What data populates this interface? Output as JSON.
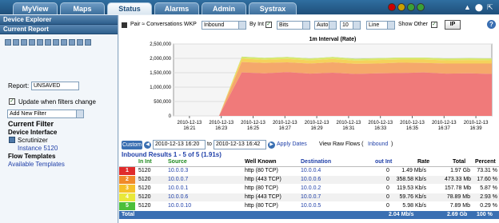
{
  "tabs": [
    "MyView",
    "Maps",
    "Status",
    "Alarms",
    "Admin",
    "Systrax"
  ],
  "active_tab": "Status",
  "status_lights": [
    "#cc0000",
    "#c9a000",
    "#3aa035",
    "#3aa035"
  ],
  "top_icons": [
    "▲",
    "⬤",
    "⇱"
  ],
  "sidebar": {
    "device_explorer": "Device Explorer",
    "current_report": "Current Report",
    "report_label": "Report:",
    "report_value": "UNSAVED",
    "update_label": "Update when filters change",
    "add_filter": "Add New Filter",
    "current_filter_title": "Current Filter",
    "device_interface_label": "Device Interface",
    "device_name": "Scrutinizer",
    "instance": "Instance 5120",
    "flow_templates_label": "Flow Templates",
    "available_templates": "Available Templates"
  },
  "controls": {
    "report_type": "Pair ≈ Conversations WKP",
    "direction": "Inbound",
    "by_int": "By Int",
    "unit": "Bits",
    "scale": "Auto",
    "top_n": "10",
    "graph_type": "Line",
    "show_other": "Show Other",
    "ip_button": "IP",
    "help": "?"
  },
  "chart_data": {
    "type": "area",
    "title": "1m Interval (Rate)",
    "ylim": [
      0,
      2500000
    ],
    "yticks": [
      "2,500,000",
      "2,000,000",
      "1,500,000",
      "1,000,000",
      "500,000",
      "0"
    ],
    "xticks": [
      "2010-12-13 16:21",
      "2010-12-13 16:23",
      "2010-12-13 16:25",
      "2010-12-13 16:27",
      "2010-12-13 16:29",
      "2010-12-13 16:31",
      "2010-12-13 16:33",
      "2010-12-13 16:35",
      "2010-12-13 16:37",
      "2010-12-13 16:39"
    ],
    "x": [
      16.35,
      16.43,
      16.45,
      16.5,
      16.55,
      16.6,
      16.65,
      16.7,
      16.75,
      16.8
    ],
    "series": [
      {
        "color": "#f07a7a",
        "values": [
          0,
          0,
          0,
          1510000,
          1480000,
          1520000,
          1470000,
          1500000,
          1460000,
          1480000,
          1490000,
          1510000,
          1470000,
          1480000,
          1460000
        ]
      },
      {
        "color": "#f5a86b",
        "values": [
          0,
          0,
          0,
          360000,
          360000,
          340000,
          350000,
          360000,
          350000,
          340000,
          360000,
          330000,
          350000,
          340000,
          360000
        ]
      },
      {
        "color": "#f5d15b",
        "values": [
          0,
          0,
          0,
          120000,
          110000,
          120000,
          110000,
          120000,
          110000,
          120000,
          110000,
          120000,
          110000,
          120000,
          110000
        ]
      },
      {
        "color": "#d9e86a",
        "values": [
          0,
          0,
          0,
          60000,
          60000,
          60000,
          60000,
          60000,
          60000,
          60000,
          60000,
          60000,
          60000,
          60000,
          60000
        ]
      },
      {
        "color": "#9cd86a",
        "values": [
          0,
          0,
          0,
          8000,
          8000,
          8000,
          8000,
          8000,
          8000,
          8000,
          8000,
          8000,
          8000,
          8000,
          8000
        ]
      }
    ]
  },
  "date_bar": {
    "custom": "Custom",
    "from": "2010-12-13 16:20",
    "to_label": "to",
    "to": "2010-12-13 16:42",
    "apply": "Apply Dates",
    "raw_flows": "View Raw Flows (",
    "raw_flows_link": "Inbound",
    "raw_flows_end": ")"
  },
  "results": {
    "title": "Inbound Results 1 - 5 of 5 (1.91s)",
    "headers": [
      "In Int",
      "Source",
      "Well Known",
      "Destination",
      "out Int",
      "Rate",
      "Total",
      "Percent"
    ],
    "rows": [
      {
        "n": "1",
        "color": "#e02b2b",
        "in": "5120",
        "src": "10.0.0.3",
        "wk": "http (80 TCP)",
        "dst": "10.0.0.4",
        "out": "0",
        "rate": "1.49 Mb/s",
        "total": "1.97 Gb",
        "pct": "73.31 %"
      },
      {
        "n": "2",
        "color": "#f08a2a",
        "in": "5120",
        "src": "10.0.0.7",
        "wk": "http (443 TCP)",
        "dst": "10.0.0.6",
        "out": "0",
        "rate": "358.58 Kb/s",
        "total": "473.33 Mb",
        "pct": "17.60 %"
      },
      {
        "n": "3",
        "color": "#f5c12a",
        "in": "5120",
        "src": "10.0.0.1",
        "wk": "http (80 TCP)",
        "dst": "10.0.0.2",
        "out": "0",
        "rate": "119.53 Kb/s",
        "total": "157.78 Mb",
        "pct": "5.87 %"
      },
      {
        "n": "4",
        "color": "#e8e83a",
        "in": "5120",
        "src": "10.0.0.6",
        "wk": "http (443 TCP)",
        "dst": "10.0.0.7",
        "out": "0",
        "rate": "59.76 Kb/s",
        "total": "78.89 Mb",
        "pct": "2.93 %"
      },
      {
        "n": "5",
        "color": "#4bbf3a",
        "in": "5120",
        "src": "10.0.0.10",
        "wk": "http (80 TCP)",
        "dst": "10.0.0.5",
        "out": "0",
        "rate": "5.98 Kb/s",
        "total": "7.89 Mb",
        "pct": "0.29 %"
      }
    ],
    "total_label": "Total",
    "total_rate": "2.04 Mb/s",
    "total_total": "2.69 Gb",
    "total_pct": "100 %"
  }
}
